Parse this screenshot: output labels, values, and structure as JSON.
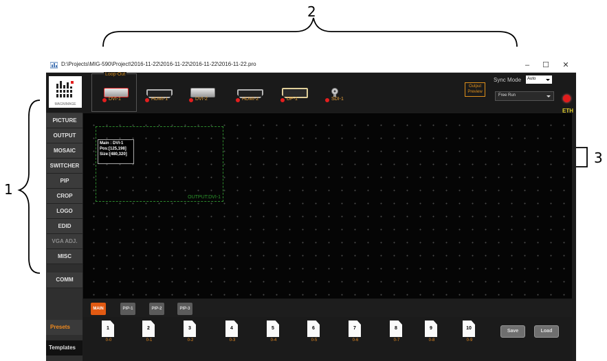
{
  "callouts": {
    "top": "2",
    "left": "1",
    "right": "3"
  },
  "window": {
    "title": "D:\\Projects\\MIG-590\\Project\\2016-11-22\\2016-11-22\\2016-11-22\\2016-11-22.pro"
  },
  "inputs": {
    "loop_out_label": "Loop-Out",
    "ports": [
      {
        "label": "DVI-1"
      },
      {
        "label": "HDMI-1"
      },
      {
        "label": "DVI-2"
      },
      {
        "label": "HDMI-2"
      },
      {
        "label": "DP-1"
      },
      {
        "label": "SDI-1"
      }
    ]
  },
  "logo": {
    "text": "MAGNIMAGE"
  },
  "output_preview": {
    "label": "Output Preview"
  },
  "sync": {
    "label": "Sync Mode",
    "value": "Auto",
    "mode_value": "Free Run"
  },
  "eth": "ETH",
  "sidebar": {
    "items": [
      {
        "label": "PICTURE"
      },
      {
        "label": "OUTPUT"
      },
      {
        "label": "MOSAIC"
      },
      {
        "label": "SWITCHER"
      },
      {
        "label": "PIP"
      },
      {
        "label": "CROP"
      },
      {
        "label": "LOGO"
      },
      {
        "label": "EDID"
      },
      {
        "label": "VGA ADJ."
      },
      {
        "label": "MISC"
      },
      {
        "label": "COMM"
      }
    ]
  },
  "canvas": {
    "output_label": "OUTPUT:DVI-1",
    "info": {
      "line1": "Main :  DVI-1",
      "line2": "Pos:[125,198]",
      "line3": "Size:[480,320]"
    }
  },
  "layers": [
    {
      "label": "MAIN"
    },
    {
      "label": "PIP-1"
    },
    {
      "label": "PIP-2"
    },
    {
      "label": "PIP-3"
    }
  ],
  "tabs": {
    "presets": "Presets",
    "templates": "Templates"
  },
  "presets": [
    {
      "num": "1",
      "sub": "0-0"
    },
    {
      "num": "2",
      "sub": "0-1"
    },
    {
      "num": "3",
      "sub": "0-2"
    },
    {
      "num": "4",
      "sub": "0-3"
    },
    {
      "num": "5",
      "sub": "0-4"
    },
    {
      "num": "6",
      "sub": "0-5"
    },
    {
      "num": "7",
      "sub": "0-6"
    },
    {
      "num": "8",
      "sub": "0-7"
    },
    {
      "num": "9",
      "sub": "0-8"
    },
    {
      "num": "10",
      "sub": "0-9"
    }
  ],
  "actions": {
    "save": "Save",
    "load": "Load"
  },
  "colors": {
    "accent_orange": "#e25a12",
    "led_red": "#e41e1e",
    "output_green": "#2d8a2d",
    "eth_yellow": "#e6d22a"
  }
}
